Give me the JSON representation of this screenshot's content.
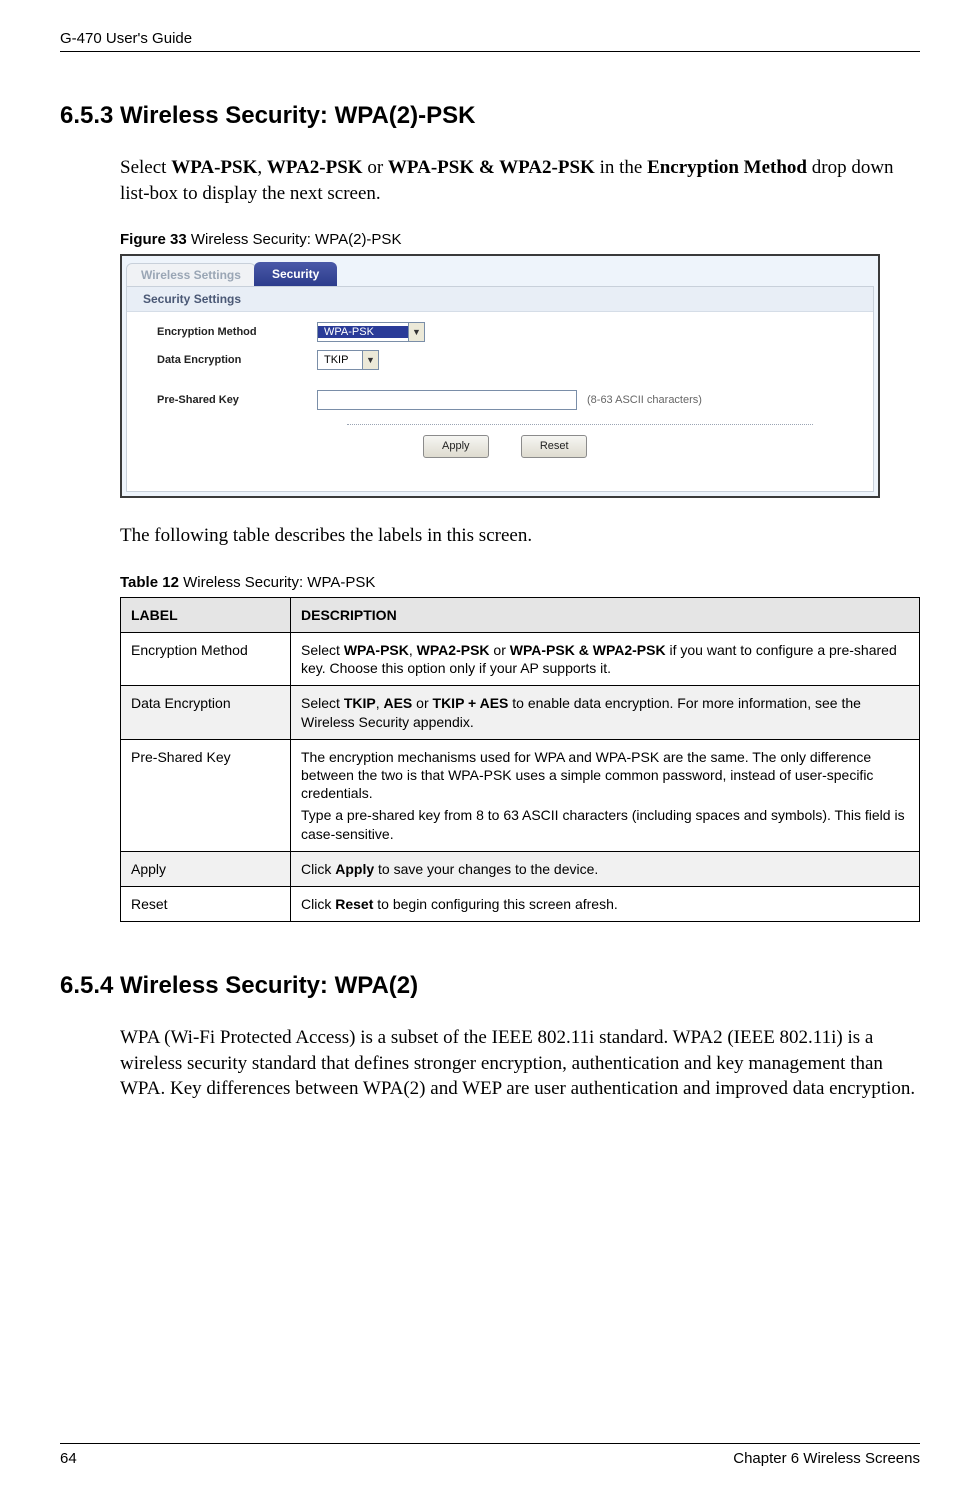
{
  "header": {
    "left": "G-470 User's Guide"
  },
  "section653": {
    "heading": "6.5.3  Wireless Security: WPA(2)-PSK",
    "para_parts": {
      "p1": "Select ",
      "b1": "WPA-PSK",
      "p2": ", ",
      "b2": "WPA2-PSK",
      "p3": " or ",
      "b3": "WPA-PSK & WPA2-PSK",
      "p4": " in the ",
      "b4": "Encryption Method",
      "p5": " drop down list-box to display the next screen."
    }
  },
  "figure33": {
    "caption_strong": "Figure 33   ",
    "caption_rest": "Wireless Security: WPA(2)-PSK",
    "tab_inactive": "Wireless Settings",
    "tab_active": "Security",
    "group_title": "Security Settings",
    "labels": {
      "encryption_method": "Encryption Method",
      "data_encryption": "Data Encryption",
      "preshared_key": "Pre-Shared Key"
    },
    "values": {
      "encryption_method": "WPA-PSK",
      "data_encryption": "TKIP"
    },
    "hint": "(8-63 ASCII characters)",
    "buttons": {
      "apply": "Apply",
      "reset": "Reset"
    }
  },
  "after_figure_para": "The following table describes the labels in this screen.",
  "table12": {
    "caption_strong": "Table 12   ",
    "caption_rest": "Wireless Security: WPA-PSK",
    "head_label": "LABEL",
    "head_desc": "DESCRIPTION",
    "rows": {
      "enc_label": "Encryption Method",
      "enc_d1": "Select ",
      "enc_b1": "WPA-PSK",
      "enc_d2": ", ",
      "enc_b2": "WPA2-PSK",
      "enc_d3": " or ",
      "enc_b3": "WPA-PSK & WPA2-PSK",
      "enc_d4": "  if you want to configure a pre-shared key. Choose this option only if your AP supports it.",
      "de_label": "Data Encryption",
      "de_d1": "Select ",
      "de_b1": "TKIP",
      "de_d2": ", ",
      "de_b2": "AES",
      "de_d3": " or ",
      "de_b3": "TKIP + AES",
      "de_d4": " to enable data encryption. For more information, see the Wireless Security appendix.",
      "psk_label": "Pre-Shared Key",
      "psk_p1": "The encryption mechanisms used for WPA and WPA-PSK are the same. The only difference between the two is that WPA-PSK uses a simple common password, instead of user-specific credentials.",
      "psk_p2": "Type a pre-shared key from 8 to 63 ASCII characters (including spaces and symbols). This field is case-sensitive.",
      "apply_label": "Apply",
      "apply_d1": "Click ",
      "apply_b1": "Apply",
      "apply_d2": " to save your changes to the device.",
      "reset_label": "Reset",
      "reset_d1": "Click ",
      "reset_b1": "Reset",
      "reset_d2": " to begin configuring this screen afresh."
    }
  },
  "section654": {
    "heading": "6.5.4  Wireless Security: WPA(2)",
    "para": "WPA (Wi-Fi Protected Access) is a subset of the IEEE 802.11i standard. WPA2 (IEEE 802.11i) is a wireless security standard that defines stronger encryption, authentication and key management than WPA. Key differences between WPA(2) and WEP are user authentication and improved data encryption."
  },
  "footer": {
    "page": "64",
    "chapter": "Chapter 6 Wireless Screens"
  }
}
